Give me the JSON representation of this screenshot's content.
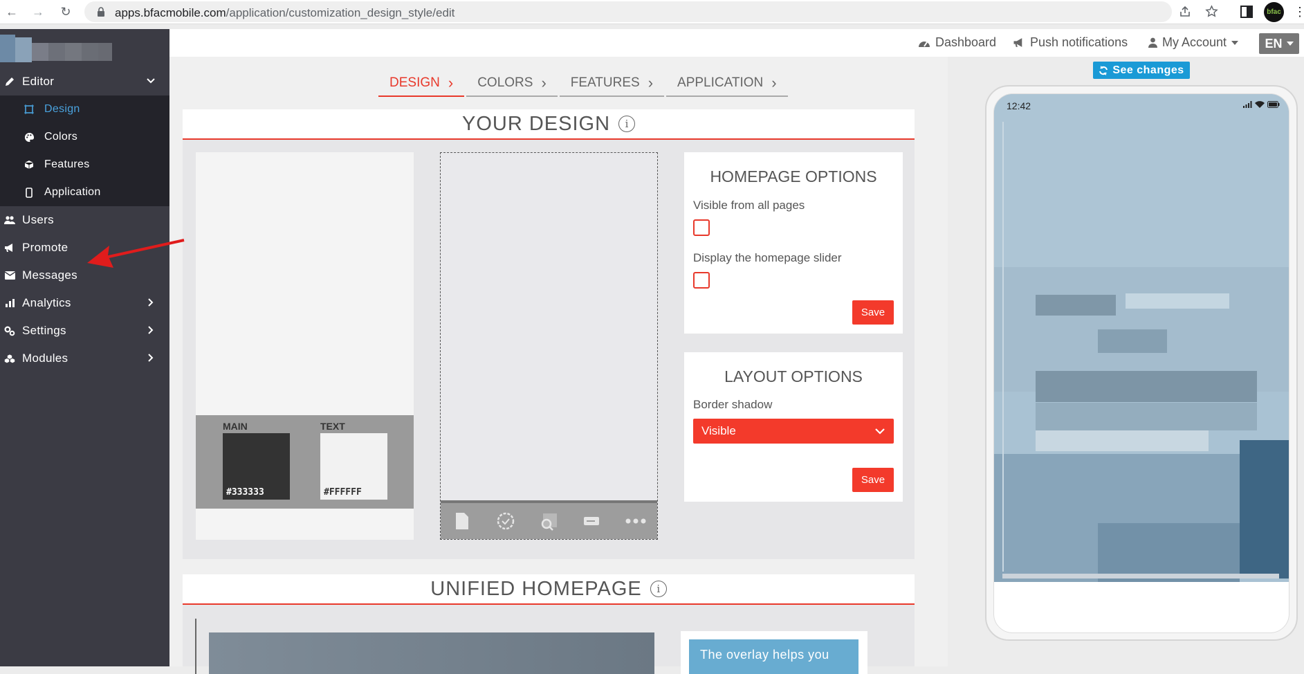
{
  "browser": {
    "url_domain": "apps.bfacmobile.com",
    "url_path": "/application/customization_design_style/edit",
    "profile_badge": "bfac"
  },
  "sidebar": {
    "editor": {
      "label": "Editor"
    },
    "sub_items": [
      {
        "label": "Design",
        "icon": "design-icon",
        "active": true
      },
      {
        "label": "Colors",
        "icon": "palette-icon"
      },
      {
        "label": "Features",
        "icon": "cube-icon"
      },
      {
        "label": "Application",
        "icon": "mobile-icon"
      }
    ],
    "items": [
      {
        "label": "Users",
        "icon": "users-icon"
      },
      {
        "label": "Promote",
        "icon": "megaphone-icon"
      },
      {
        "label": "Messages",
        "icon": "envelope-icon"
      },
      {
        "label": "Analytics",
        "icon": "chart-icon"
      },
      {
        "label": "Settings",
        "icon": "cogs-icon"
      },
      {
        "label": "Modules",
        "icon": "cubes-icon"
      }
    ]
  },
  "topbar": {
    "dashboard": "Dashboard",
    "push": "Push notifications",
    "account": "My Account",
    "lang": "EN"
  },
  "steps": [
    {
      "label": "DESIGN",
      "active": true
    },
    {
      "label": "COLORS"
    },
    {
      "label": "FEATURES"
    },
    {
      "label": "APPLICATION"
    }
  ],
  "design_panel": {
    "title": "YOUR DESIGN",
    "info": "i",
    "swatches": {
      "main_label": "MAIN",
      "main_value": "#333333",
      "text_label": "TEXT",
      "text_value": "#FFFFFF"
    },
    "homepage_options": {
      "title": "HOMEPAGE OPTIONS",
      "visible_label": "Visible from all pages",
      "slider_label": "Display the homepage slider",
      "save": "Save"
    },
    "layout_options": {
      "title": "LAYOUT OPTIONS",
      "shadow_label": "Border shadow",
      "shadow_value": "Visible",
      "save": "Save"
    }
  },
  "unified_panel": {
    "title": "UNIFIED HOMEPAGE",
    "info": "i",
    "tip": "The overlay helps you"
  },
  "phone": {
    "see_changes": "See changes",
    "time": "12:42"
  },
  "colors": {
    "accent": "#e8392b",
    "sidebar": "#3b3b44",
    "blue": "#1a9ad6"
  }
}
